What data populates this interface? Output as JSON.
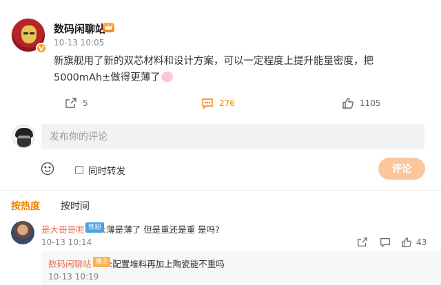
{
  "post": {
    "author": "数码闲聊站",
    "verified_badge": "V",
    "time": "10-13 10:05",
    "text": "新旗舰用了新的双芯材料和设计方案，可以一定程度上提升能量密度，把5000mAh±做得更薄了",
    "share_count": "5",
    "comment_count": "276",
    "like_count": "1105"
  },
  "composer": {
    "placeholder": "发布你的评论",
    "repost_label": "同时转发",
    "submit_label": "评论"
  },
  "tabs": {
    "hot": "按热度",
    "time": "按时间"
  },
  "comments": [
    {
      "user": "是大哥哥呢",
      "badge": "铁粉",
      "text": "薄是薄了 但是重还是重 是吗?",
      "time": "10-13 10:14",
      "likes": "43",
      "reply": {
        "user": "数码闲聊站",
        "badge": "博主",
        "text": "配置堆料再加上陶瓷能不重吗",
        "time": "10-13 10:19"
      }
    }
  ],
  "colors": {
    "accent": "#f08300",
    "username": "#eb7350",
    "submit_disabled": "#fcc69c",
    "fan_badge": "#4aa1e8",
    "blogger_badge": "#ffb24d"
  },
  "icons": {
    "share": "share-icon",
    "comment": "comment-icon",
    "like": "thumbs-up-icon",
    "emoji": "emoji-icon",
    "reply": "reply-icon"
  }
}
